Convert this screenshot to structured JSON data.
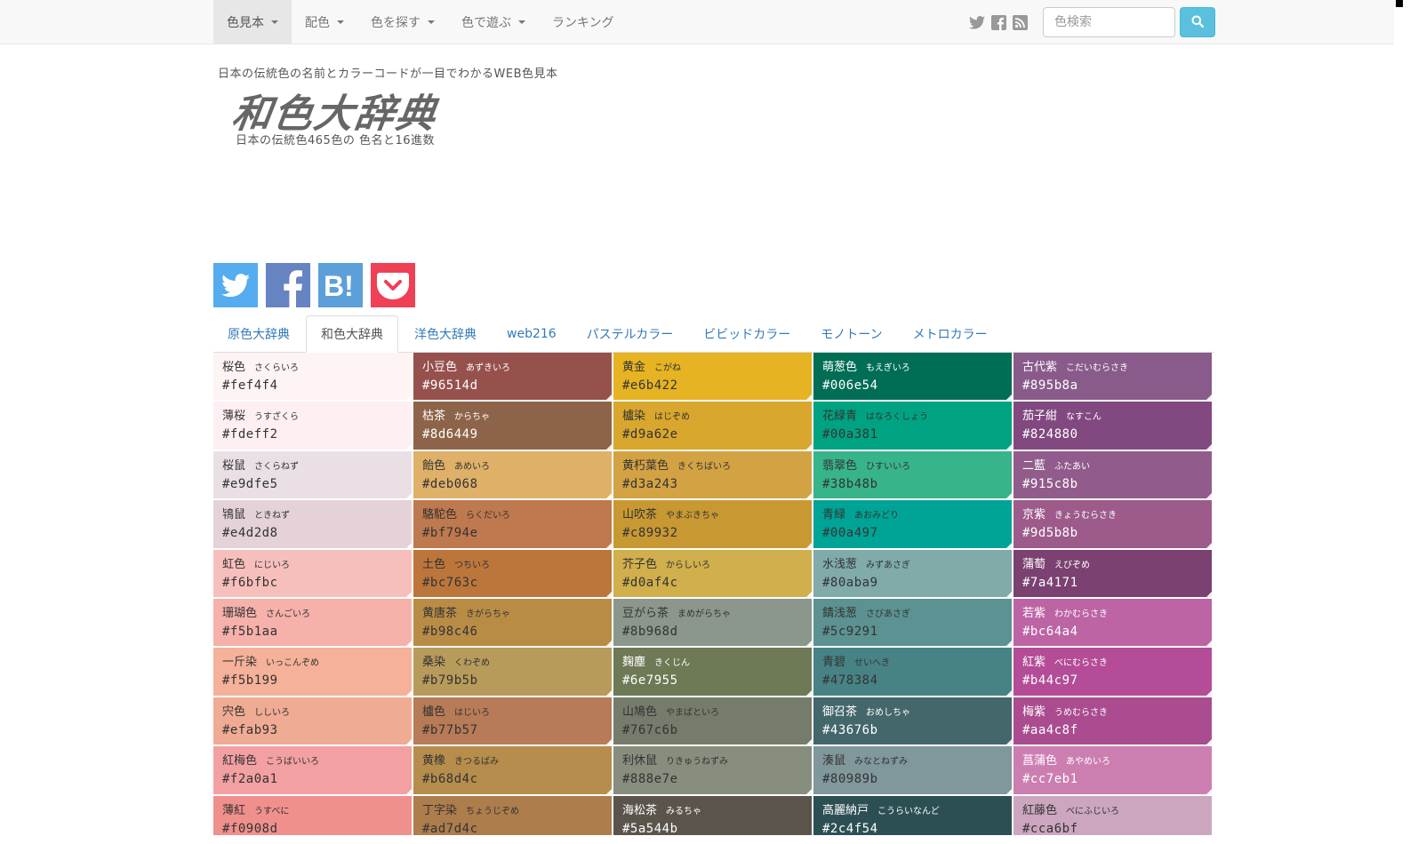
{
  "nav": {
    "items": [
      {
        "label": "色見本",
        "dropdown": true,
        "active": true
      },
      {
        "label": "配色",
        "dropdown": true,
        "active": false
      },
      {
        "label": "色を探す",
        "dropdown": true,
        "active": false
      },
      {
        "label": "色で遊ぶ",
        "dropdown": true,
        "active": false
      },
      {
        "label": "ランキング",
        "dropdown": false,
        "active": false
      }
    ],
    "search_placeholder": "色検索",
    "social_icons": [
      "twitter-icon",
      "facebook-icon",
      "rss-icon"
    ]
  },
  "header": {
    "tagline": "日本の伝統色の名前とカラーコードが一目でわかるWEB色見本",
    "logo": "和色大辞典",
    "subtitle": "日本の伝統色465色の 色名と16進数"
  },
  "share": {
    "buttons": [
      {
        "name": "twitter-share",
        "color": "#55acee"
      },
      {
        "name": "facebook-share",
        "color": "#6683c2"
      },
      {
        "name": "hatena-share",
        "color": "#5d9fd9"
      },
      {
        "name": "pocket-share",
        "color": "#ef4056"
      }
    ]
  },
  "tabs": [
    {
      "label": "原色大辞典",
      "active": false
    },
    {
      "label": "和色大辞典",
      "active": true
    },
    {
      "label": "洋色大辞典",
      "active": false
    },
    {
      "label": "web216",
      "active": false
    },
    {
      "label": "パステルカラー",
      "active": false
    },
    {
      "label": "ビビッドカラー",
      "active": false
    },
    {
      "label": "モノトーン",
      "active": false
    },
    {
      "label": "メトロカラー",
      "active": false
    }
  ],
  "colors": [
    {
      "name": "桜色",
      "reading": "さくらいろ",
      "hex": "#fef4f4",
      "dark": false
    },
    {
      "name": "小豆色",
      "reading": "あずきいろ",
      "hex": "#96514d",
      "dark": true
    },
    {
      "name": "黄金",
      "reading": "こがね",
      "hex": "#e6b422",
      "dark": false
    },
    {
      "name": "萌葱色",
      "reading": "もえぎいろ",
      "hex": "#006e54",
      "dark": true
    },
    {
      "name": "古代紫",
      "reading": "こだいむらさき",
      "hex": "#895b8a",
      "dark": true
    },
    {
      "name": "薄桜",
      "reading": "うすざくら",
      "hex": "#fdeff2",
      "dark": false
    },
    {
      "name": "枯茶",
      "reading": "からちゃ",
      "hex": "#8d6449",
      "dark": true
    },
    {
      "name": "櫨染",
      "reading": "はじぞめ",
      "hex": "#d9a62e",
      "dark": false
    },
    {
      "name": "花緑青",
      "reading": "はなろくしょう",
      "hex": "#00a381",
      "dark": false
    },
    {
      "name": "茄子紺",
      "reading": "なすこん",
      "hex": "#824880",
      "dark": true
    },
    {
      "name": "桜鼠",
      "reading": "さくらねず",
      "hex": "#e9dfe5",
      "dark": false
    },
    {
      "name": "飴色",
      "reading": "あめいろ",
      "hex": "#deb068",
      "dark": false
    },
    {
      "name": "黄朽葉色",
      "reading": "きくちばいろ",
      "hex": "#d3a243",
      "dark": false
    },
    {
      "name": "翡翠色",
      "reading": "ひすいいろ",
      "hex": "#38b48b",
      "dark": false
    },
    {
      "name": "二藍",
      "reading": "ふたあい",
      "hex": "#915c8b",
      "dark": true
    },
    {
      "name": "鴇鼠",
      "reading": "ときねず",
      "hex": "#e4d2d8",
      "dark": false
    },
    {
      "name": "駱駝色",
      "reading": "らくだいろ",
      "hex": "#bf794e",
      "dark": false
    },
    {
      "name": "山吹茶",
      "reading": "やまぶきちゃ",
      "hex": "#c89932",
      "dark": false
    },
    {
      "name": "青緑",
      "reading": "あおみどり",
      "hex": "#00a497",
      "dark": false
    },
    {
      "name": "京紫",
      "reading": "きょうむらさき",
      "hex": "#9d5b8b",
      "dark": true
    },
    {
      "name": "虹色",
      "reading": "にじいろ",
      "hex": "#f6bfbc",
      "dark": false
    },
    {
      "name": "土色",
      "reading": "つちいろ",
      "hex": "#bc763c",
      "dark": false
    },
    {
      "name": "芥子色",
      "reading": "からしいろ",
      "hex": "#d0af4c",
      "dark": false
    },
    {
      "name": "水浅葱",
      "reading": "みずあさぎ",
      "hex": "#80aba9",
      "dark": false
    },
    {
      "name": "蒲萄",
      "reading": "えびぞめ",
      "hex": "#7a4171",
      "dark": true
    },
    {
      "name": "珊瑚色",
      "reading": "さんごいろ",
      "hex": "#f5b1aa",
      "dark": false
    },
    {
      "name": "黄唐茶",
      "reading": "きがらちゃ",
      "hex": "#b98c46",
      "dark": false
    },
    {
      "name": "豆がら茶",
      "reading": "まめがらちゃ",
      "hex": "#8b968d",
      "dark": false
    },
    {
      "name": "錆浅葱",
      "reading": "さびあさぎ",
      "hex": "#5c9291",
      "dark": false
    },
    {
      "name": "若紫",
      "reading": "わかむらさき",
      "hex": "#bc64a4",
      "dark": true
    },
    {
      "name": "一斤染",
      "reading": "いっこんぞめ",
      "hex": "#f5b199",
      "dark": false
    },
    {
      "name": "桑染",
      "reading": "くわぞめ",
      "hex": "#b79b5b",
      "dark": false
    },
    {
      "name": "麹塵",
      "reading": "きくじん",
      "hex": "#6e7955",
      "dark": true
    },
    {
      "name": "青碧",
      "reading": "せいへき",
      "hex": "#478384",
      "dark": false
    },
    {
      "name": "紅紫",
      "reading": "べにむらさき",
      "hex": "#b44c97",
      "dark": true
    },
    {
      "name": "宍色",
      "reading": "ししいろ",
      "hex": "#efab93",
      "dark": false
    },
    {
      "name": "櫨色",
      "reading": "はじいろ",
      "hex": "#b77b57",
      "dark": false
    },
    {
      "name": "山鳩色",
      "reading": "やまばといろ",
      "hex": "#767c6b",
      "dark": false
    },
    {
      "name": "御召茶",
      "reading": "おめしちゃ",
      "hex": "#43676b",
      "dark": true
    },
    {
      "name": "梅紫",
      "reading": "うめむらさき",
      "hex": "#aa4c8f",
      "dark": true
    },
    {
      "name": "紅梅色",
      "reading": "こうばいいろ",
      "hex": "#f2a0a1",
      "dark": false
    },
    {
      "name": "黄橡",
      "reading": "きつるばみ",
      "hex": "#b68d4c",
      "dark": false
    },
    {
      "name": "利休鼠",
      "reading": "りきゅうねずみ",
      "hex": "#888e7e",
      "dark": false
    },
    {
      "name": "湊鼠",
      "reading": "みなとねずみ",
      "hex": "#80989b",
      "dark": false
    },
    {
      "name": "菖蒲色",
      "reading": "あやめいろ",
      "hex": "#cc7eb1",
      "dark": true
    },
    {
      "name": "薄紅",
      "reading": "うすべに",
      "hex": "#f0908d",
      "dark": false
    },
    {
      "name": "丁字染",
      "reading": "ちょうじぞめ",
      "hex": "#ad7d4c",
      "dark": false
    },
    {
      "name": "海松茶",
      "reading": "みるちゃ",
      "hex": "#5a544b",
      "dark": true
    },
    {
      "name": "高麗納戸",
      "reading": "こうらいなんど",
      "hex": "#2c4f54",
      "dark": true
    },
    {
      "name": "紅藤色",
      "reading": "べにふじいろ",
      "hex": "#cca6bf",
      "dark": false
    }
  ]
}
